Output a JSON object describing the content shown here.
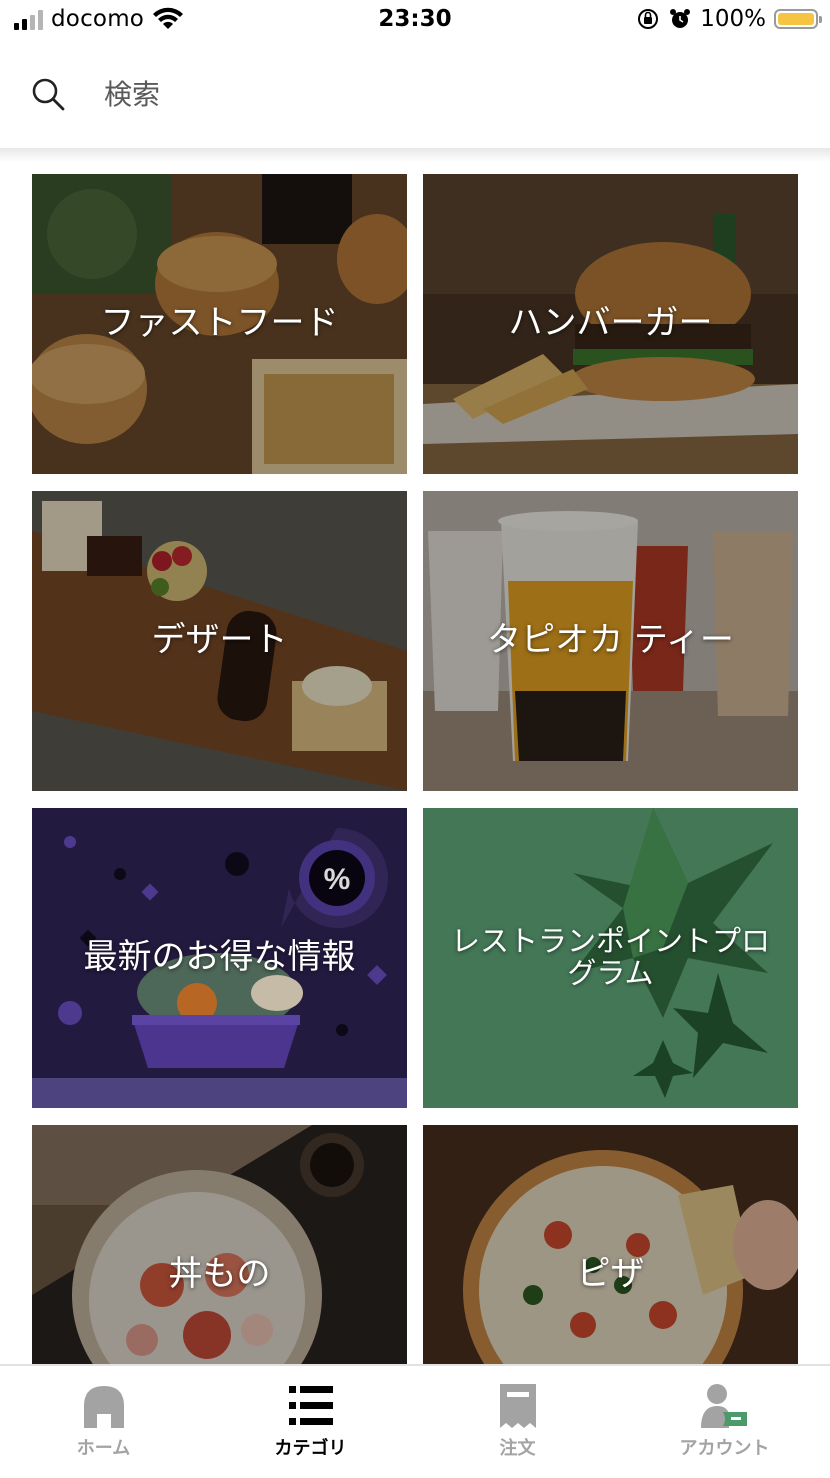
{
  "status_bar": {
    "carrier": "docomo",
    "time": "23:30",
    "battery_percent": "100%",
    "battery_level": 1.0,
    "battery_color": "#f6c443"
  },
  "search": {
    "placeholder": "検索",
    "icon": "search-icon"
  },
  "categories": [
    {
      "label": "ファストフード"
    },
    {
      "label": "ハンバーガー"
    },
    {
      "label": "デザート"
    },
    {
      "label": "タピオカ ティー"
    },
    {
      "label": "最新のお得な情報"
    },
    {
      "label": "レストランポイントプログラム"
    },
    {
      "label": "丼もの"
    },
    {
      "label": "ピザ"
    }
  ],
  "tabs": [
    {
      "label": "ホーム",
      "icon": "home-icon",
      "active": false
    },
    {
      "label": "カテゴリ",
      "icon": "list-icon",
      "active": true
    },
    {
      "label": "注文",
      "icon": "receipt-icon",
      "active": false
    },
    {
      "label": "アカウント",
      "icon": "account-icon",
      "active": false
    }
  ],
  "colors": {
    "deals_bg": "#2a1f4a",
    "rewards_bg": "#4b8560",
    "active_tab": "#000000",
    "inactive_tab": "#a3a3a3"
  }
}
